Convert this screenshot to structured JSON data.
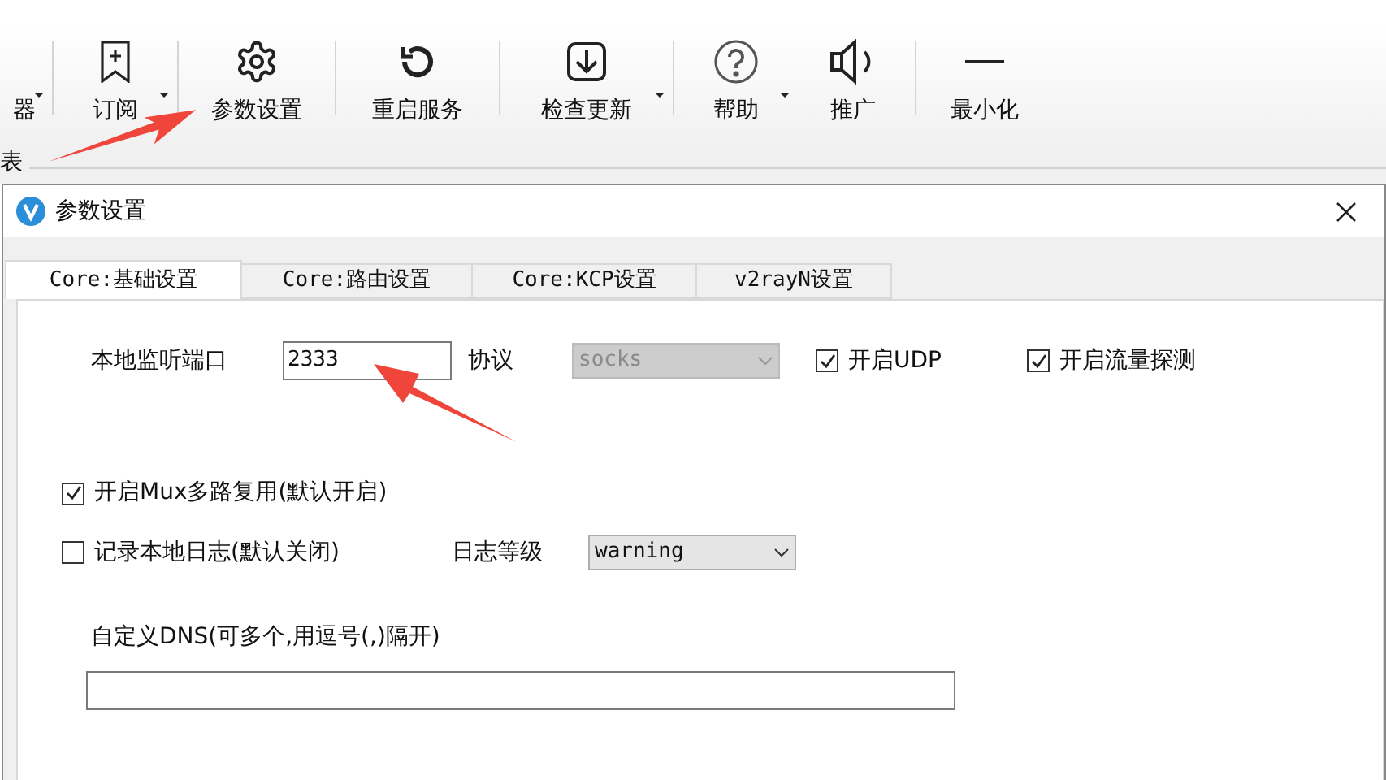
{
  "toolbar": {
    "items": [
      {
        "label": "器",
        "has_menu": true
      },
      {
        "label": "订阅",
        "has_menu": true
      },
      {
        "label": "参数设置",
        "has_menu": false
      },
      {
        "label": "重启服务",
        "has_menu": false
      },
      {
        "label": "检查更新",
        "has_menu": true
      },
      {
        "label": "帮助",
        "has_menu": true
      },
      {
        "label": "推广",
        "has_menu": false
      },
      {
        "label": "最小化",
        "has_menu": false
      }
    ]
  },
  "section_label": "表",
  "dialog": {
    "title": "参数设置",
    "tabs": [
      {
        "label": "Core:基础设置",
        "selected": true
      },
      {
        "label": "Core:路由设置",
        "selected": false
      },
      {
        "label": "Core:KCP设置",
        "selected": false
      },
      {
        "label": "v2rayN设置",
        "selected": false
      }
    ],
    "port": {
      "label": "本地监听端口",
      "value": "2333"
    },
    "protocol": {
      "label": "协议",
      "value": "socks",
      "disabled": true
    },
    "udp": {
      "label": "开启UDP",
      "checked": true
    },
    "sniffing": {
      "label": "开启流量探测",
      "checked": true
    },
    "mux": {
      "label": "开启Mux多路复用(默认开启)",
      "checked": true
    },
    "log": {
      "label": "记录本地日志(默认关闭)",
      "checked": false
    },
    "log_level": {
      "label": "日志等级",
      "value": "warning",
      "disabled": false
    },
    "dns": {
      "label": "自定义DNS(可多个,用逗号(,)隔开)"
    }
  }
}
